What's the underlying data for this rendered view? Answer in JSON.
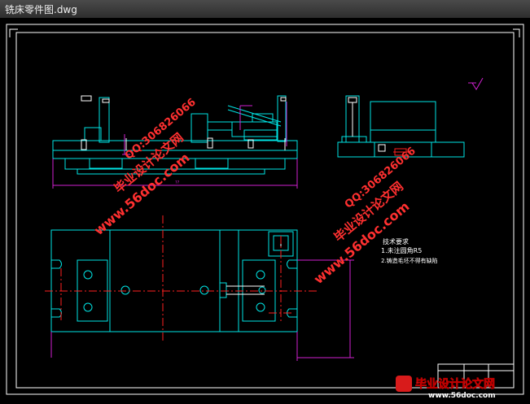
{
  "window": {
    "title": "铣床零件图.dwg"
  },
  "drawing": {
    "dimension_label": "??",
    "tech_notes": {
      "heading": "技术要求",
      "line1": "1.未注圆角R5",
      "line2": "2.铸造毛坯不得有缺陷"
    }
  },
  "watermarks": {
    "site_url": "www.56doc.com",
    "qq": "QQ:306826066",
    "brand": "毕业设计论文网",
    "footer_brand": "毕业设计论文网",
    "footer_url": "www.56doc.com"
  },
  "colors": {
    "background": "#000000",
    "outline": "#00e5e5",
    "white": "#ffffff",
    "center_line": "#ff2020",
    "dimension": "#d020d0",
    "watermark_red": "#ff3030"
  }
}
